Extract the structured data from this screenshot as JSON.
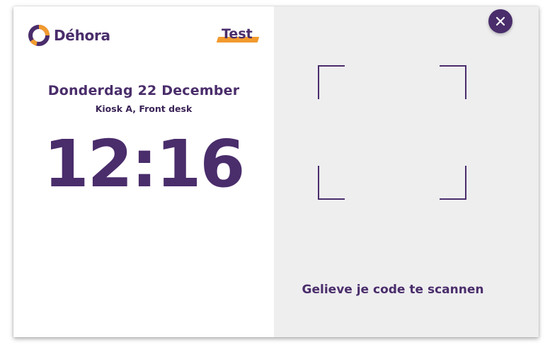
{
  "brand": {
    "name": "Déhora",
    "icon": "dehora-ring-logo",
    "primary_color": "#4a2d6b",
    "accent_color": "#f29a2e"
  },
  "environment_badge": {
    "label": "Test"
  },
  "clock_panel": {
    "date": "Donderdag 22 December",
    "location": "Kiosk A, Front desk",
    "time": "12:16"
  },
  "scanner_panel": {
    "instruction": "Gelieve je code te scannen",
    "background_color": "#eeeeef",
    "close_icon": "close-icon"
  }
}
